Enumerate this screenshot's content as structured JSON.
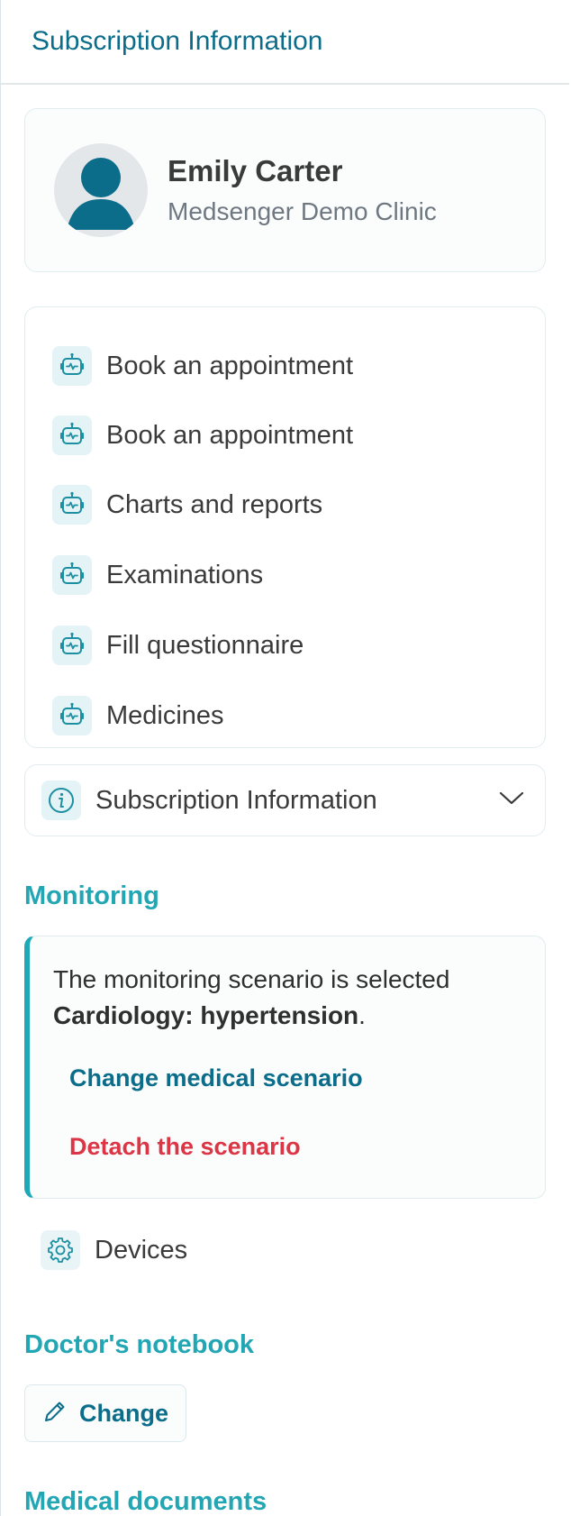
{
  "header": {
    "title": "Subscription Information"
  },
  "profile": {
    "name": "Emily Carter",
    "clinic": "Medsenger Demo Clinic"
  },
  "actions": [
    {
      "label": "Book an appointment",
      "icon": "robot-icon"
    },
    {
      "label": "Book an appointment",
      "icon": "robot-icon"
    },
    {
      "label": "Charts and reports",
      "icon": "robot-icon"
    },
    {
      "label": "Examinations",
      "icon": "robot-icon"
    },
    {
      "label": "Fill questionnaire",
      "icon": "robot-icon"
    },
    {
      "label": "Medicines",
      "icon": "robot-icon"
    }
  ],
  "subscription": {
    "label": "Subscription Information",
    "icon": "info-icon",
    "toggle_icon": "chevron-down-icon"
  },
  "monitoring": {
    "title": "Monitoring",
    "text_prefix": "The monitoring scenario is selected",
    "scenario": "Cardiology: hypertension",
    "text_suffix": ".",
    "change_label": "Change medical scenario",
    "detach_label": "Detach the scenario"
  },
  "devices": {
    "label": "Devices",
    "icon": "gear-icon"
  },
  "notebook": {
    "title": "Doctor's notebook",
    "change_label": "Change",
    "icon": "pencil-icon"
  },
  "documents": {
    "title": "Medical documents"
  },
  "colors": {
    "primary": "#0c6d8a",
    "accent": "#22a6b3",
    "danger": "#dc3545",
    "icon_bg": "#e3f3f6"
  }
}
